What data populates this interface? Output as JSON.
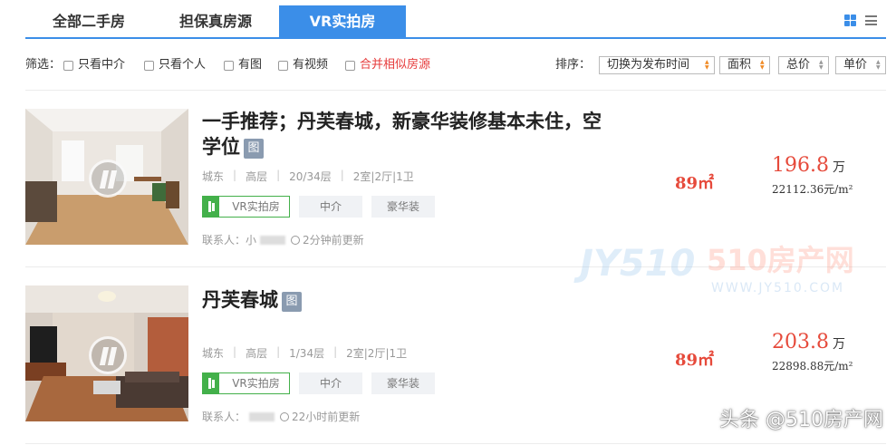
{
  "tabs": [
    {
      "label": "全部二手房",
      "active": false
    },
    {
      "label": "担保真房源",
      "active": false
    },
    {
      "label": "VR实拍房",
      "active": true
    }
  ],
  "filters": {
    "label": "筛选：",
    "options": [
      {
        "label": "只看中介",
        "checked": false
      },
      {
        "label": "只看个人",
        "checked": false
      },
      {
        "label": "有图",
        "checked": false
      },
      {
        "label": "有视频",
        "checked": false
      },
      {
        "label": "合并相似房源",
        "checked": false,
        "highlight": "#e63b3b"
      }
    ]
  },
  "sort": {
    "label": "排序：",
    "options": [
      {
        "label": "切换为发布时间"
      },
      {
        "label": "面积"
      },
      {
        "label": "总价"
      },
      {
        "label": "单价"
      }
    ]
  },
  "listings": [
    {
      "title_line1": "一手推荐；丹芙春城，新豪华装修基本未住，空",
      "title_line2": "学位",
      "pic_badge": "图",
      "meta": [
        "城东",
        "高层",
        "20/34层",
        "2室|2厅|1卫"
      ],
      "tags": [
        "VR实拍房",
        "中介",
        "豪华装"
      ],
      "contact_label": "联系人：",
      "contact_name": "小",
      "updated": "2分钟前更新",
      "area": "89㎡",
      "price": "196.8",
      "price_unit": "万",
      "unit_price": "22112.36元/m²"
    },
    {
      "title_line1": "丹芙春城",
      "pic_badge": "图",
      "meta": [
        "城东",
        "高层",
        "1/34层",
        "2室|2厅|1卫"
      ],
      "tags": [
        "VR实拍房",
        "中介",
        "豪华装"
      ],
      "contact_label": "联系人：",
      "updated": "22小时前更新",
      "area": "89㎡",
      "price": "203.8",
      "price_unit": "万",
      "unit_price": "22898.88元/m²"
    }
  ],
  "watermark": {
    "site_text": "510房产网",
    "domain": "WWW.JY510.COM",
    "logo": "JY510",
    "corner": "头条 @510房产网"
  },
  "colors": {
    "accent": "#3b8ee8",
    "price": "#e64a3b",
    "vr_green": "#43b04a"
  },
  "icons": [
    "grid-view-icon",
    "list-view-icon",
    "vr-play-icon",
    "vr-tag-icon",
    "clock-icon"
  ]
}
